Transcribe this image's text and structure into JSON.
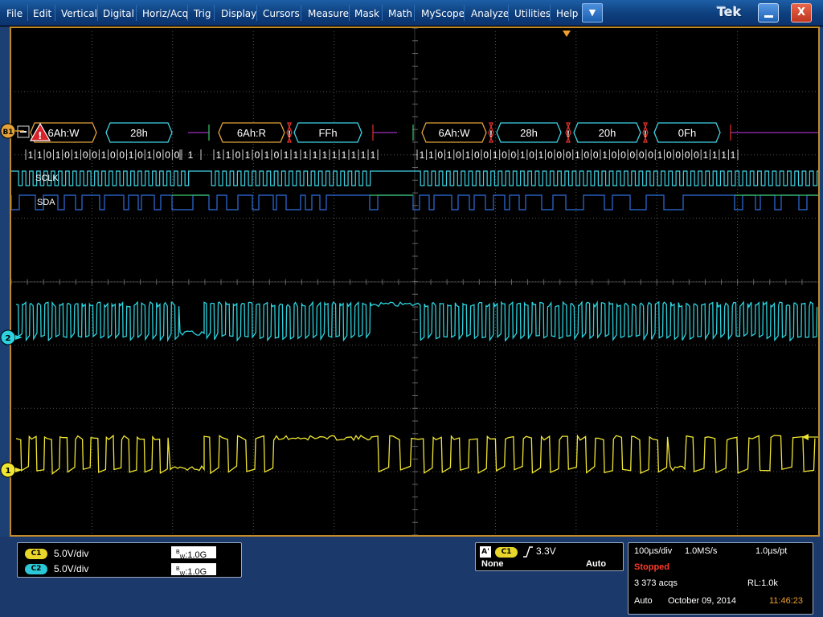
{
  "menu": {
    "items": [
      "File",
      "Edit",
      "Vertical",
      "Digital",
      "Horiz/Acq",
      "Trig",
      "Display",
      "Cursors",
      "Measure",
      "Mask",
      "Math",
      "MyScope",
      "Analyze",
      "Utilities",
      "Help"
    ],
    "dropdown_icon": "chevron-down-icon",
    "logo": "Tek",
    "minimize_icon": "minimize-icon",
    "close_label": "X"
  },
  "waveform": {
    "bus_label": "B1",
    "clock_label": "SCLK",
    "data_label": "SDA",
    "ch2_marker": "2",
    "ch1_marker": "1",
    "error_icon": "warning-icon",
    "collapse_icon": "minus-icon",
    "trigger_position_icon": "trigger-position-icon",
    "trigger_level_icon": "trigger-level-icon",
    "colors": {
      "bus_frame": "#e3a33a",
      "bus_text": "#ffffff",
      "address_frame": "#e3a33a",
      "data_frame": "#3fd4e6",
      "error_frame": "#e0322a",
      "idle_line": "#a030c0",
      "sclk": "#3fd4e6",
      "sda_high": "#3ac86a",
      "sda_low": "#2f6fe0",
      "ch2": "#2cd2de",
      "ch1": "#f0e632",
      "border": "#c08a2a"
    }
  },
  "decode_packets": [
    {
      "kind": "address",
      "label": "6Ah:W"
    },
    {
      "kind": "data",
      "label": "28h"
    },
    {
      "kind": "address",
      "label": "6Ah:R"
    },
    {
      "kind": "error",
      "label": "!"
    },
    {
      "kind": "data",
      "label": "FFh"
    },
    {
      "kind": "address",
      "label": "6Ah:W"
    },
    {
      "kind": "error",
      "label": "!"
    },
    {
      "kind": "data",
      "label": "28h"
    },
    {
      "kind": "error",
      "label": "!"
    },
    {
      "kind": "data",
      "label": "20h"
    },
    {
      "kind": "error",
      "label": "!"
    },
    {
      "kind": "data",
      "label": "0Fh"
    }
  ],
  "bit_groups": [
    "1|1|0|1|0|1|0|0|1|0|0|1|0|1|0|0|0",
    "1",
    "1|1|0|1|0|1|0|1|1|1|1|1|1|1|1|1|1",
    "1|1|0|1|0|1|0|0|1|0|0|1|0|1|0|0|0|1|0|0|1|0|0|0|0|0|1|0|0|0|0|1|1|1|1"
  ],
  "channels": [
    {
      "badge": "C1",
      "scale": "5.0V/div",
      "bw": "1.0G",
      "color": "#e8d62a"
    },
    {
      "badge": "C2",
      "scale": "5.0V/div",
      "bw": "1.0G",
      "color": "#2cc8d8"
    }
  ],
  "bw_prefix": "B",
  "bw_sub": "W",
  "trigger": {
    "mode_label": "A'",
    "source": "C1",
    "slope_icon": "rising-edge-icon",
    "level": "3.3V",
    "coupling": "None",
    "mode": "Auto"
  },
  "acquisition": {
    "timebase": "100µs/div",
    "sample_rate": "1.0MS/s",
    "resolution": "1.0µs/pt",
    "state": "Stopped",
    "acqs": "3 373 acqs",
    "record_length": "RL:1.0k",
    "mode": "Auto",
    "date": "October 09, 2014",
    "time": "11:46:23",
    "state_color": "#ff3a2a",
    "time_color": "#f0a030"
  }
}
